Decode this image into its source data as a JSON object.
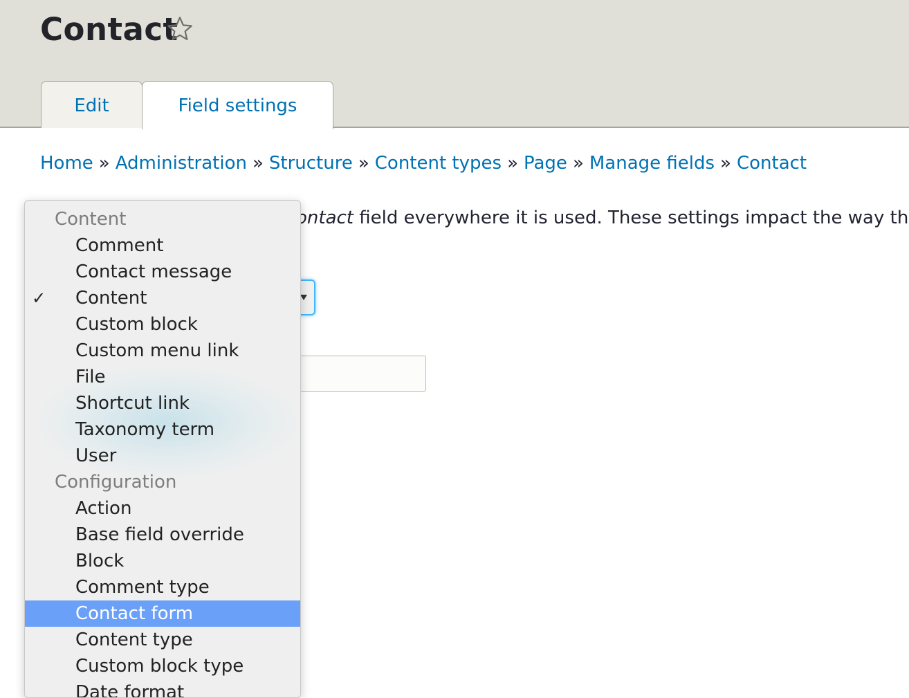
{
  "header": {
    "title": "Contact",
    "tabs": [
      {
        "label": "Edit"
      },
      {
        "label": "Field settings"
      }
    ]
  },
  "breadcrumb": [
    "Home",
    "Administration",
    "Structure",
    "Content types",
    "Page",
    "Manage fields",
    "Contact"
  ],
  "breadcrumb_separator": "»",
  "description": {
    "italic": "ontact",
    "text": " field everywhere it is used. These settings impact the way that d"
  },
  "dropdown": {
    "groups": [
      {
        "label": "Content",
        "options": [
          "Comment",
          "Contact message",
          "Content",
          "Custom block",
          "Custom menu link",
          "File",
          "Shortcut link",
          "Taxonomy term",
          "User"
        ]
      },
      {
        "label": "Configuration",
        "options": [
          "Action",
          "Base field override",
          "Block",
          "Comment type",
          "Contact form",
          "Content type",
          "Custom block type",
          "Date format"
        ]
      }
    ],
    "checked": "Content",
    "highlighted": "Contact form",
    "check_mark": "✓"
  },
  "colors": {
    "link": "#0071b3",
    "header_bg": "#e0e0d8",
    "highlight": "#6aa0f7",
    "focus_ring": "#40b6ff"
  },
  "icons": {
    "favorite": "star-outline-icon",
    "select_arrow": "triangle-down-icon"
  }
}
